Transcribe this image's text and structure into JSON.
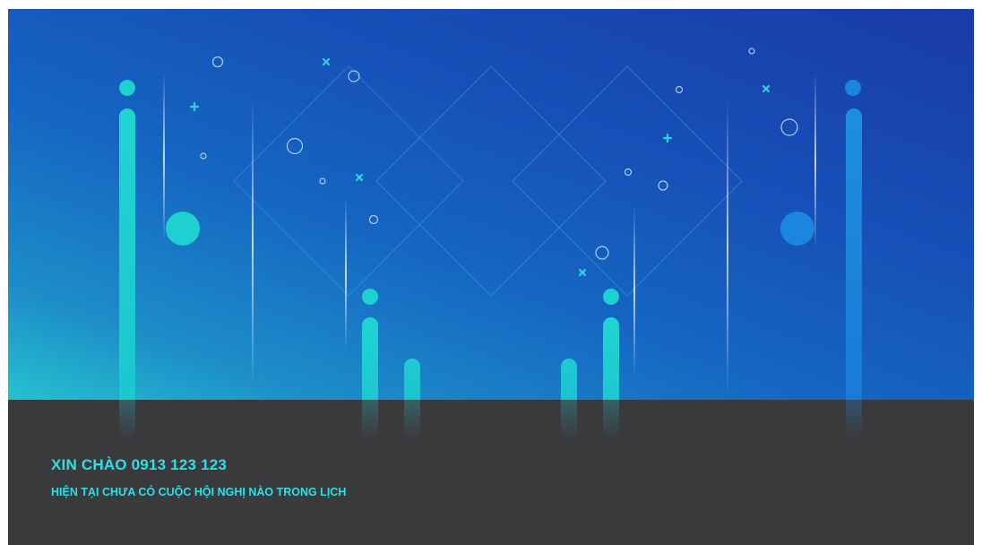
{
  "footer": {
    "greeting": "XIN CHÀO 0913 123 123",
    "status": "HIỆN TẠI CHƯA CÓ CUỘC HỘI NGHỊ NÀO TRONG LỊCH"
  },
  "colors": {
    "accent_text": "#2ee0e6",
    "footer_bg": "#3a3a3c",
    "bar_teal": "#1ecfd0",
    "bar_blue": "#1a7fd6",
    "bg_blue": "#1650b8"
  },
  "decorations": {
    "icons": [
      "pill-bar",
      "dot-circle",
      "ring-circle",
      "plus-icon",
      "cross-icon",
      "diamond-outline",
      "light-streak"
    ]
  }
}
